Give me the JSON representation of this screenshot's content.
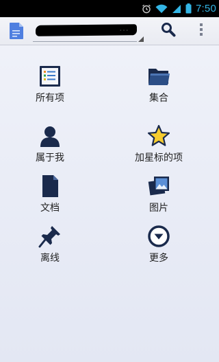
{
  "status_bar": {
    "time": "7:50",
    "icons": [
      "alarm-icon",
      "wifi-icon",
      "signal-icon",
      "battery-icon"
    ]
  },
  "action_bar": {
    "account_text": "…",
    "icons": [
      "drive-app-icon",
      "search-icon",
      "overflow-menu-icon"
    ]
  },
  "grid": {
    "items": [
      {
        "label": "所有项",
        "icon": "all-items-icon"
      },
      {
        "label": "集合",
        "icon": "collections-folder-icon"
      },
      {
        "label": "属于我",
        "icon": "owned-by-me-person-icon"
      },
      {
        "label": "加星标的项",
        "icon": "starred-icon"
      },
      {
        "label": "文档",
        "icon": "document-icon"
      },
      {
        "label": "图片",
        "icon": "photos-icon"
      },
      {
        "label": "离线",
        "icon": "offline-pin-icon"
      },
      {
        "label": "更多",
        "icon": "more-chevron-icon"
      }
    ]
  },
  "colors": {
    "accent_blue": "#33b5e5",
    "icon_navy": "#1a2a4c",
    "star_yellow": "#f6cc2f"
  }
}
